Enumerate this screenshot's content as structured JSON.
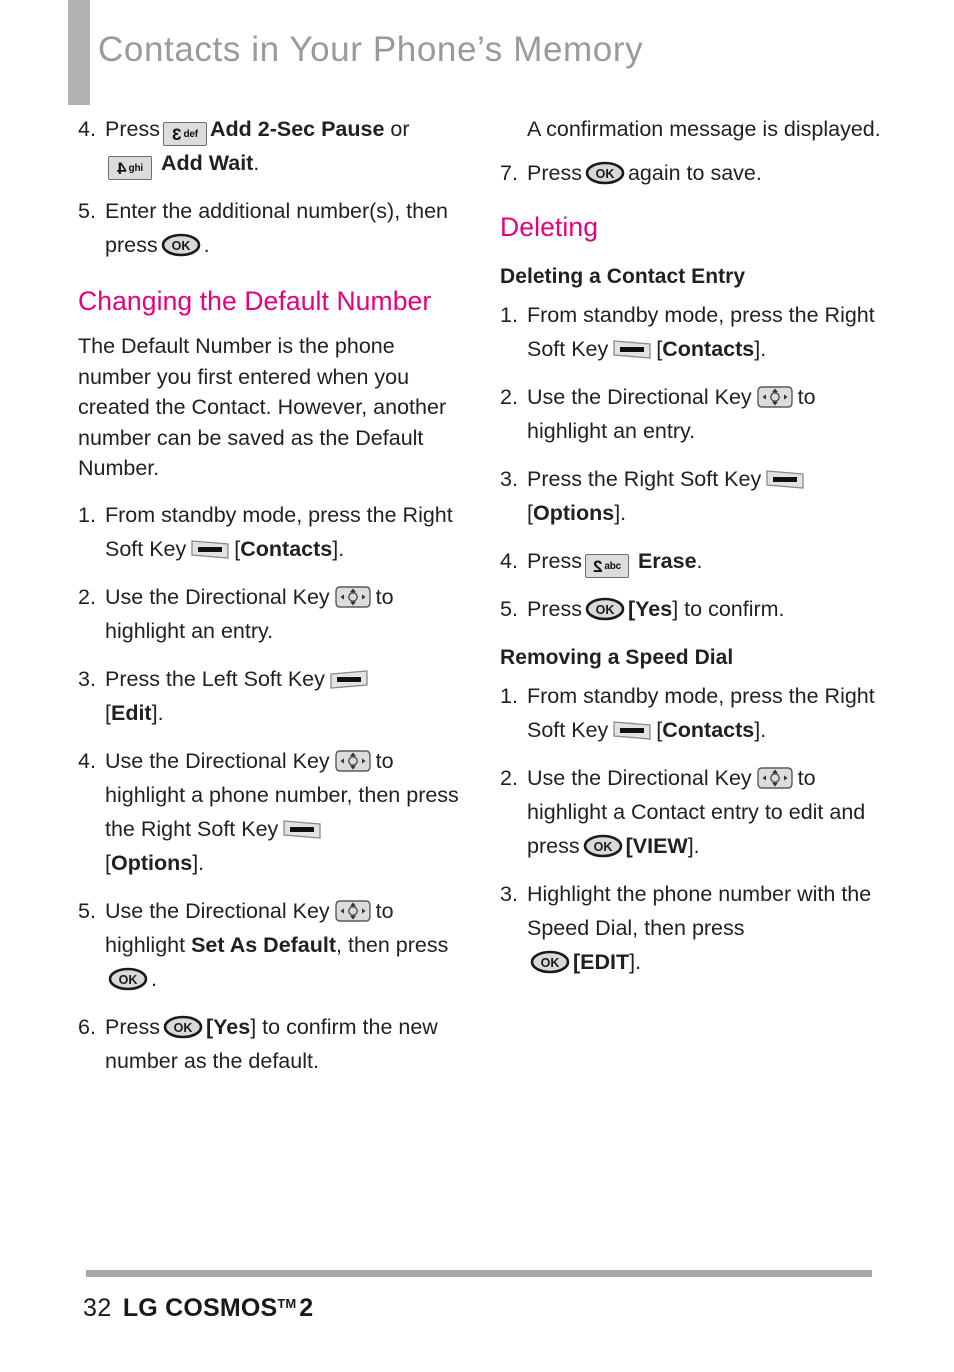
{
  "header": {
    "title": "Contacts in Your Phone’s Memory",
    "accent_bar_color": "#b2b2b2",
    "title_color": "#9a9a9a"
  },
  "colors": {
    "pink_heading": "#e6007e",
    "body_text": "#231f20",
    "rule": "#a8a8a8"
  },
  "icons": {
    "key_3_digit": "3",
    "key_3_letters": "def",
    "key_4_digit": "4",
    "key_4_letters": "ghi",
    "key_2_digit": "2",
    "key_2_letters": "abc",
    "ok_label": "OK"
  },
  "left_column": {
    "step4": {
      "num": "4.",
      "t1": "Press",
      "t2": "Add 2-Sec Pause",
      "t3": "or",
      "t4": "Add Wait",
      "t5": "."
    },
    "step5": {
      "num": "5.",
      "t1": "Enter the additional number(s), then press",
      "t2": "."
    },
    "heading_changing_default": "Changing the Default Number",
    "para_default": "The Default Number is the phone number you first entered when you created the Contact. However, another number can be saved as the Default Number.",
    "steps": [
      {
        "num": "1.",
        "t1": "From standby mode, press the Right Soft Key",
        "t2": "[",
        "t3": "Contacts",
        "t4": "]."
      },
      {
        "num": "2.",
        "t1": "Use the Directional Key",
        "t2": "to highlight an entry."
      },
      {
        "num": "3.",
        "t1": "Press the Left Soft Key",
        "t2": "[",
        "t3": "Edit",
        "t4": "]."
      },
      {
        "num": "4.",
        "t1": "Use the Directional Key",
        "t2": "to highlight a phone number, then press the Right Soft Key",
        "t3": "[",
        "t4": "Options",
        "t5": "]."
      },
      {
        "num": "5.",
        "t1": "Use the Directional Key",
        "t2": "to highlight",
        "t3": "Set As Default",
        "t4": ", then press",
        "t5": "."
      },
      {
        "num": "6.",
        "t1": "Press",
        "t2": "[",
        "t3": "Yes",
        "t4": "] to confirm the new number as the default."
      }
    ]
  },
  "right_column": {
    "note_confirmation": "A confirmation message is displayed.",
    "step7": {
      "num": "7.",
      "t1": "Press",
      "t2": "again to save."
    },
    "heading_deleting": "Deleting",
    "subheading_delete_contact": "Deleting a Contact Entry",
    "delete_steps": [
      {
        "num": "1.",
        "t1": "From standby mode, press the Right Soft Key",
        "t2": "[",
        "t3": "Contacts",
        "t4": "]."
      },
      {
        "num": "2.",
        "t1": "Use the Directional Key",
        "t2": "to highlight an entry."
      },
      {
        "num": "3.",
        "t1": "Press the Right Soft Key",
        "t2": "[",
        "t3": "Options",
        "t4": "]."
      },
      {
        "num": "4.",
        "t1": "Press",
        "t2": "Erase",
        "t3": "."
      },
      {
        "num": "5.",
        "t1": "Press",
        "t2": "[",
        "t3": "Yes",
        "t4": "] to confirm."
      }
    ],
    "subheading_remove_speed_dial": "Removing a Speed Dial",
    "speed_dial_steps": [
      {
        "num": "1.",
        "t1": "From standby mode, press the Right Soft Key",
        "t2": "[",
        "t3": "Contacts",
        "t4": "]."
      },
      {
        "num": "2.",
        "t1": "Use the Directional Key",
        "t2": "to highlight a Contact entry to edit and press",
        "t3": "[",
        "t4": "VIEW",
        "t5": "]."
      },
      {
        "num": "3.",
        "t1": "Highlight the phone number with the Speed Dial, then press",
        "t2": "[",
        "t3": "EDIT",
        "t4": "]."
      }
    ]
  },
  "footer": {
    "page_number": "32",
    "brand": "LG COSMOS",
    "trademark": "TM",
    "model": "2"
  }
}
